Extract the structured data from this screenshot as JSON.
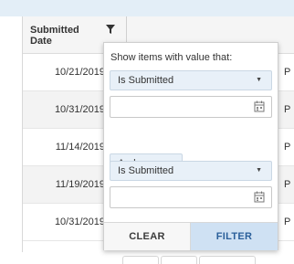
{
  "grid": {
    "column_header": "Submitted Date",
    "rows": [
      {
        "date": "10/21/2019",
        "next": "P"
      },
      {
        "date": "10/31/2019",
        "next": "P"
      },
      {
        "date": "11/14/2019",
        "next": "P"
      },
      {
        "date": "11/19/2019",
        "next": "P"
      },
      {
        "date": "10/31/2019",
        "next": "P"
      }
    ]
  },
  "filter_popup": {
    "title": "Show items with value that:",
    "operator_1": "Is Submitted",
    "value_1": "",
    "logic": "And",
    "operator_2": "Is Submitted",
    "value_2": "",
    "clear_label": "CLEAR",
    "filter_label": "FILTER"
  },
  "icons": {
    "filter": "filter-icon",
    "calendar": "calendar-icon",
    "dropdown": "caret-down-icon"
  },
  "colors": {
    "header_strip": "#e3eef7",
    "dropdown_bg": "#e8f0f8",
    "filter_button_bg": "#cfe1f3",
    "filter_button_text": "#2a5f9a"
  }
}
